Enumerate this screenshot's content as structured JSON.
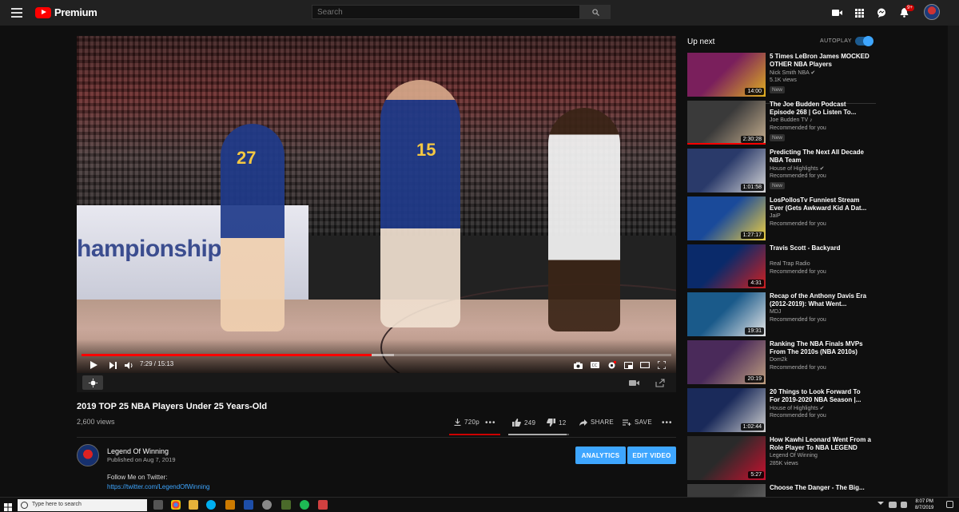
{
  "topbar": {
    "logo_text": "Premium",
    "search_placeholder": "Search",
    "notification_count": "9+"
  },
  "player": {
    "banner_text": "hampionship",
    "jersey_numbers": [
      "27",
      "15"
    ],
    "time_display": "7:29 / 15:13",
    "progress": {
      "played_fraction": 0.492,
      "buffered_fraction": 0.53
    }
  },
  "video": {
    "title": "2019 TOP 25 NBA Players Under 25 Years-Old",
    "views": "2,600 views",
    "quality_label": "720p",
    "likes": "249",
    "dislikes": "12",
    "share_label": "SHARE",
    "save_label": "SAVE",
    "like_fraction": 0.954
  },
  "channel": {
    "name": "Legend Of Winning",
    "published": "Published on Aug 7, 2019",
    "analytics_label": "ANALYTICS",
    "edit_label": "EDIT VIDEO",
    "description_line1": "Follow Me on Twitter:",
    "description_link": "https://twitter.com/LegendOfWinning"
  },
  "sidebar": {
    "up_next_label": "Up next",
    "autoplay_label": "AUTOPLAY",
    "autoplay_on": true,
    "items": [
      {
        "title": "5 Times LeBron James MOCKED OTHER NBA Players",
        "channel": "Nick Smith NBA ✔",
        "meta": "5.1K views",
        "badge": "New",
        "duration": "14:00",
        "color1": "#7a1f5c",
        "color2": "#e0b020"
      },
      {
        "title": "The Joe Budden Podcast Episode 268 | Go Listen To...",
        "channel": "Joe Budden TV ♪",
        "meta": "Recommended for you",
        "badge": "New",
        "duration": "2:30:28",
        "color1": "#3a3a3a",
        "color2": "#c8b090"
      },
      {
        "title": "Predicting The Next All Decade NBA Team",
        "channel": "House of Highlights ✔",
        "meta": "Recommended for you",
        "badge": "New",
        "duration": "1:01:58",
        "color1": "#2a3a6a",
        "color2": "#d8d8d8"
      },
      {
        "title": "LosPollosTv Funniest Stream Ever (Gets Awkward Kid A Dat...",
        "channel": "JaiP",
        "meta": "Recommended for you",
        "badge": "",
        "duration": "1:27:17",
        "color1": "#1a4a9a",
        "color2": "#f0d040"
      },
      {
        "title": "Travis Scott - Backyard",
        "channel": "Real Trap Radio",
        "meta": "Recommended for you",
        "badge": "",
        "duration": "4:31",
        "color1": "#0a2a6a",
        "color2": "#d02020"
      },
      {
        "title": "Recap of the Anthony Davis Era (2012-2019): What Went...",
        "channel": "MDJ",
        "meta": "Recommended for you",
        "badge": "",
        "duration": "19:31",
        "color1": "#1a5a8a",
        "color2": "#e8e8e8"
      },
      {
        "title": "Ranking The NBA Finals MVPs From The 2010s (NBA 2010s)",
        "channel": "Dom2k",
        "meta": "Recommended for you",
        "badge": "",
        "duration": "20:19",
        "color1": "#4a2a5a",
        "color2": "#c0a080"
      },
      {
        "title": "20 Things to Look Forward To For 2019-2020 NBA Season |...",
        "channel": "House of Highlights ✔",
        "meta": "Recommended for you",
        "badge": "",
        "duration": "1:02:44",
        "color1": "#1a2a5a",
        "color2": "#d0d0d0"
      },
      {
        "title": "How Kawhi Leonard Went From a Role Player To NBA LEGEND",
        "channel": "Legend Of Winning",
        "meta": "285K views",
        "badge": "",
        "duration": "5:27",
        "color1": "#2a2a2a",
        "color2": "#c8102e"
      },
      {
        "title": "Choose The Danger - The Big...",
        "channel": "",
        "meta": "",
        "badge": "",
        "duration": "",
        "color1": "#3a3a3a",
        "color2": "#777"
      }
    ]
  },
  "taskbar": {
    "search_placeholder": "Type here to search",
    "time": "8:07 PM",
    "date": "8/7/2019"
  }
}
